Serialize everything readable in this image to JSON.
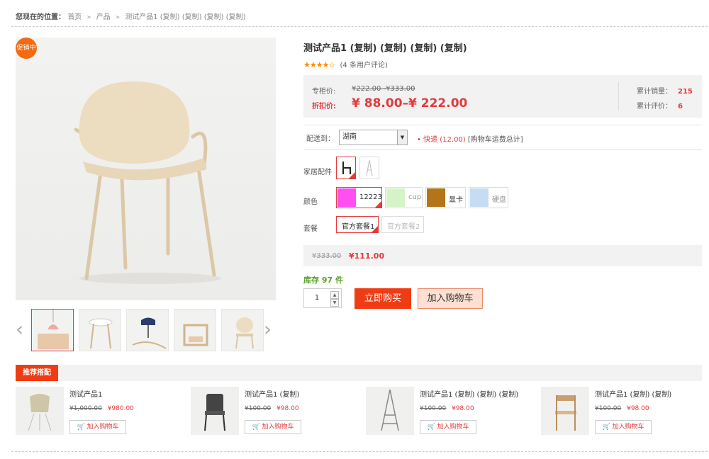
{
  "breadcrumb": {
    "label": "您现在的位置：",
    "items": [
      "首页",
      "产品",
      "测试产品1 (复制) (复制) (复制) (复制)"
    ],
    "sep": "»"
  },
  "badge": "促销中",
  "product": {
    "title": "测试产品1 (复制) (复制) (复制) (复制)",
    "stars": "★★★★☆",
    "reviews": "(4 条用户评论)",
    "counter_label": "专柜价:",
    "counter_price": "¥222.00 -¥333.00",
    "discount_label": "折扣价:",
    "discount_price": "¥ 88.00–¥ 222.00",
    "sales_label": "累计销量：",
    "sales_value": "215",
    "review_label": "累计评价：",
    "review_value": "6"
  },
  "shipping": {
    "label": "配送到：",
    "selected": "湖南",
    "dot": "•",
    "express": "快递 (12.00)",
    "note": "[购物车运费总计]"
  },
  "options": {
    "fittings_label": "家居配件",
    "color_label": "颜色",
    "colors": [
      {
        "name": "12223",
        "color": "#ff4ff0"
      },
      {
        "name": "cup",
        "color": "#d4f4c8"
      },
      {
        "name": "显卡",
        "color": "#b47518"
      },
      {
        "name": "硬盘",
        "color": "#c6dcf2"
      }
    ],
    "package_label": "套餐",
    "packages": [
      "官方套餐1",
      "官方套餐2"
    ]
  },
  "package_price": {
    "old": "¥333.00",
    "new": "¥111.00"
  },
  "stock": "库存 97 件",
  "quantity": "1",
  "buttons": {
    "buy": "立即购买",
    "cart": "加入购物车"
  },
  "recommend": {
    "title": "推荐搭配",
    "items": [
      {
        "name": "测试产品1",
        "old": "¥1,000.00",
        "new": "¥980.00",
        "cart": "加入购物车"
      },
      {
        "name": "测试产品1 (复制)",
        "old": "¥100.00",
        "new": "¥98.00",
        "cart": "加入购物车"
      },
      {
        "name": "测试产品1 (复制) (复制) (复制)",
        "old": "¥100.00",
        "new": "¥98.00",
        "cart": "加入购物车"
      },
      {
        "name": "测试产品1 (复制) (复制)",
        "old": "¥100.00",
        "new": "¥98.00",
        "cart": "加入购物车"
      }
    ]
  }
}
